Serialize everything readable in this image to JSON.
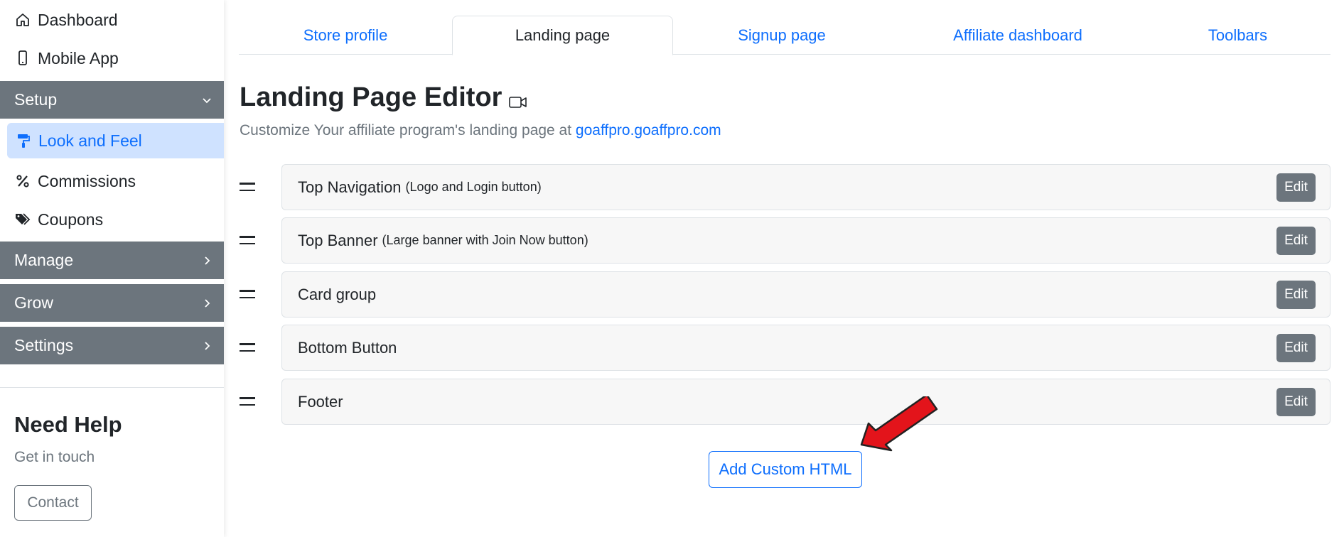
{
  "sidebar": {
    "top_items": [
      {
        "label": "Dashboard",
        "icon": "home-icon"
      },
      {
        "label": "Mobile App",
        "icon": "mobile-icon"
      }
    ],
    "sections": {
      "setup": {
        "label": "Setup",
        "items": [
          {
            "label": "Look and Feel",
            "icon": "paint-roller-icon",
            "active": true
          },
          {
            "label": "Commissions",
            "icon": "percent-icon"
          },
          {
            "label": "Coupons",
            "icon": "tags-icon"
          }
        ]
      },
      "manage": {
        "label": "Manage"
      },
      "grow": {
        "label": "Grow"
      },
      "settings": {
        "label": "Settings"
      }
    },
    "help": {
      "title": "Need Help",
      "subtitle": "Get in touch",
      "contact_label": "Contact"
    }
  },
  "tabs": [
    {
      "label": "Store profile",
      "active": false
    },
    {
      "label": "Landing page",
      "active": true
    },
    {
      "label": "Signup page",
      "active": false
    },
    {
      "label": "Affiliate dashboard",
      "active": false
    },
    {
      "label": "Toolbars",
      "active": false
    }
  ],
  "editor": {
    "title": "Landing Page Editor",
    "subtitle_prefix": "Customize Your affiliate program's landing page at",
    "subtitle_link": "goaffpro.goaffpro.com",
    "sections": [
      {
        "name": "Top Navigation",
        "desc": "(Logo and Login button)",
        "edit_label": "Edit"
      },
      {
        "name": "Top Banner",
        "desc": "(Large banner with Join Now button)",
        "edit_label": "Edit"
      },
      {
        "name": "Card group",
        "desc": "",
        "edit_label": "Edit"
      },
      {
        "name": "Bottom Button",
        "desc": "",
        "edit_label": "Edit"
      },
      {
        "name": "Footer",
        "desc": "",
        "edit_label": "Edit"
      }
    ],
    "add_button_label": "Add Custom HTML"
  },
  "colors": {
    "primary": "#0d6efd",
    "secondary": "#6c757d",
    "active_bg": "#cfe2ff",
    "arrow": "#e3141b"
  }
}
